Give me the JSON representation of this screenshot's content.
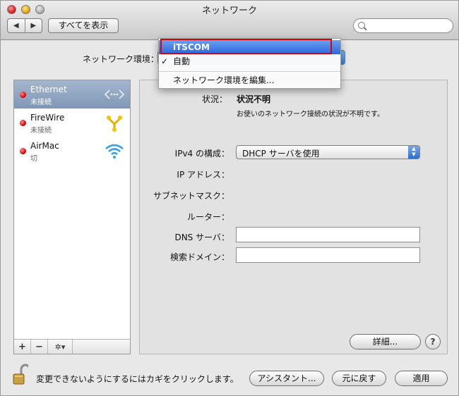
{
  "window": {
    "title": "ネットワーク"
  },
  "toolbar": {
    "back_label": "◀",
    "forward_label": "▶",
    "show_all_label": "すべてを表示",
    "search_placeholder": ""
  },
  "location": {
    "label": "ネットワーク環境："
  },
  "location_menu": {
    "items": [
      "iTSCOM",
      "自動",
      "ネットワーク環境を編集..."
    ],
    "highlighted": "iTSCOM",
    "checked": "自動",
    "checkmark": "✓"
  },
  "services": [
    {
      "name": "Ethernet",
      "status": "未接続",
      "icon": "ethernet-icon",
      "selected": true
    },
    {
      "name": "FireWire",
      "status": "未接続",
      "icon": "firewire-icon",
      "selected": false
    },
    {
      "name": "AirMac",
      "status": "切",
      "icon": "wifi-icon",
      "selected": false
    }
  ],
  "sidebar_bottom": {
    "add": "+",
    "remove": "−",
    "action": "✲▾"
  },
  "detail": {
    "status_label": "状況：",
    "status_value": "状況不明",
    "status_description": "お使いのネットワーク接続の状況が不明です。",
    "ipv4_label": "IPv4 の構成：",
    "ipv4_value": "DHCP サーバを使用",
    "ip_label": "IP アドレス：",
    "subnet_label": "サブネットマスク：",
    "router_label": "ルーター：",
    "dns_label": "DNS サーバ：",
    "dns_value": "",
    "search_domain_label": "検索ドメイン：",
    "search_domain_value": "",
    "advanced_label": "詳細...",
    "help_label": "?"
  },
  "footer": {
    "lock_text": "変更できないようにするにはカギをクリックします。",
    "assistant_label": "アシスタント...",
    "revert_label": "元に戻す",
    "apply_label": "適用"
  },
  "colors": {
    "highlight": "#2c67de",
    "annotation_box": "#e00000",
    "status_dot": "#d10000"
  }
}
